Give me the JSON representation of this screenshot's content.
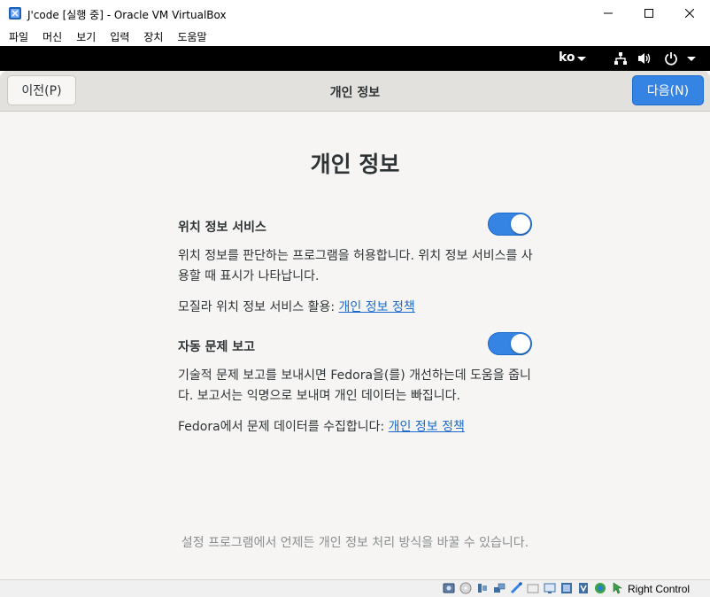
{
  "window": {
    "title": "J'code [실행 중] - Oracle VM VirtualBox",
    "app_icon": "virtualbox-icon",
    "controls": [
      "minimize-icon",
      "maximize-icon",
      "close-icon"
    ]
  },
  "menubar": {
    "items": [
      "파일",
      "머신",
      "보기",
      "입력",
      "장치",
      "도움말"
    ]
  },
  "gnome_bar": {
    "language": "ko",
    "tray_icons": [
      "network-icon",
      "volume-icon",
      "power-icon"
    ]
  },
  "headerbar": {
    "prev_label": "이전(P)",
    "title": "개인 정보",
    "next_label": "다음(N)"
  },
  "main": {
    "page_title": "개인 정보",
    "location": {
      "label": "위치 정보 서비스",
      "enabled": true,
      "description": "위치 정보를 판단하는 프로그램을 허용합니다. 위치 정보 서비스를 사용할 때 표시가 나타납니다.",
      "policy_prefix": "모질라 위치 정보 서비스 활용: ",
      "policy_link": "개인 정보 정책"
    },
    "reporting": {
      "label": "자동 문제 보고",
      "enabled": true,
      "description": "기술적 문제 보고를 보내시면 Fedora을(를) 개선하는데 도움을 줍니다. 보고서는 익명으로 보내며 개인 데이터는 빠집니다.",
      "policy_prefix": "Fedora에서 문제 데이터를 수집합니다: ",
      "policy_link": "개인 정보 정책"
    },
    "footer_note": "설정 프로그램에서 언제든 개인 정보 처리 방식을 바꿀 수 있습니다."
  },
  "statusbar": {
    "host_key": "Right Control",
    "accent": "#3584e4"
  }
}
